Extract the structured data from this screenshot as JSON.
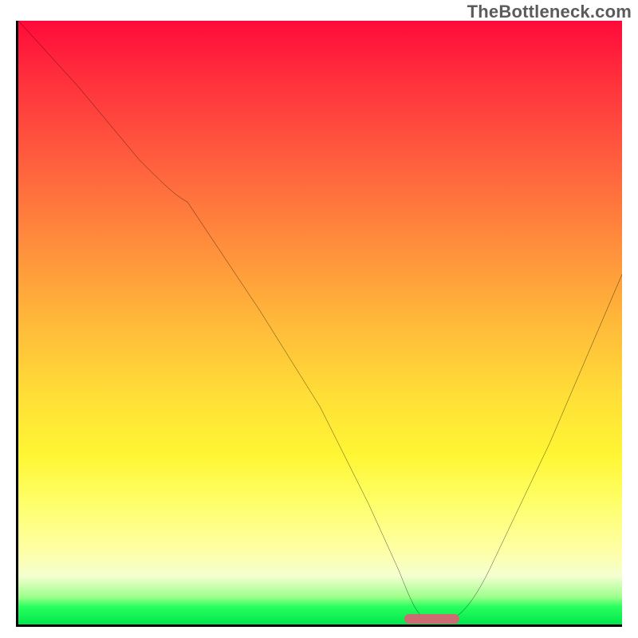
{
  "watermark": "TheBottleneck.com",
  "chart_data": {
    "type": "line",
    "title": "",
    "xlabel": "",
    "ylabel": "",
    "xlim": [
      0,
      100
    ],
    "ylim": [
      0,
      100
    ],
    "grid": false,
    "legend": false,
    "background": {
      "type": "vertical-gradient",
      "stops": [
        {
          "pos": 0,
          "color": "#ff0a3a"
        },
        {
          "pos": 50,
          "color": "#ffb93a"
        },
        {
          "pos": 72,
          "color": "#fff634"
        },
        {
          "pos": 97,
          "color": "#2bff60"
        },
        {
          "pos": 100,
          "color": "#00e74b"
        }
      ]
    },
    "series": [
      {
        "name": "bottleneck-curve",
        "color": "#000000",
        "x": [
          0,
          10,
          20,
          28,
          40,
          50,
          58,
          63,
          67,
          72,
          78,
          88,
          100
        ],
        "y": [
          100,
          89,
          77,
          70,
          52,
          36,
          20,
          9,
          2,
          1,
          6,
          30,
          58
        ]
      }
    ],
    "annotations": [
      {
        "name": "optimal-marker",
        "type": "bar",
        "color": "#cc6b72",
        "x_start": 64,
        "x_end": 73,
        "y": 0
      }
    ]
  }
}
